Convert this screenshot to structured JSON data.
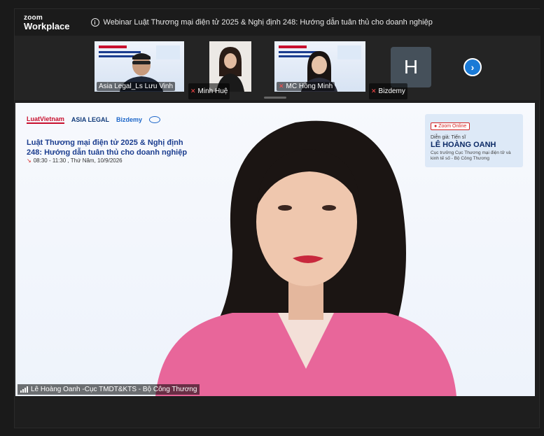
{
  "app": {
    "brand_line1": "zoom",
    "brand_line2": "Workplace"
  },
  "meeting": {
    "title": "Webinar Luật Thương mại điện tử 2025 & Nghị định 248: Hướng dẫn tuân thủ cho doanh nghiệp"
  },
  "participants": [
    {
      "name": "Asia Legal_Ls Lưu Vinh",
      "muted": false
    },
    {
      "name": "Minh Huệ",
      "muted": true
    },
    {
      "name": "MC Hồng Minh",
      "muted": true
    },
    {
      "name": "Bizdemy",
      "muted": true,
      "avatar_letter": "H"
    }
  ],
  "slide": {
    "logos": [
      "LuatVietnam",
      "ASIA LEGAL",
      "Bizdemy"
    ],
    "title": "Luật Thương mại điện tử 2025 & Nghị định 248: Hướng dẫn tuân thủ cho doanh nghiệp",
    "time": "08:30 - 11:30 , Thứ Năm, 10/9/2026",
    "zoom_tag": "Zoom Online",
    "speaker_role": "Diễn giả: Tiến sĩ",
    "speaker_name": "LÊ HOÀNG OANH",
    "speaker_desc": "Cục trưởng Cục Thương mại điện tử và kinh tế số - Bộ Công Thương"
  },
  "active_speaker": {
    "label": "Lê Hoàng Oanh -Cục TMDT&KTS - Bộ Công Thương"
  },
  "colors": {
    "accent": "#1a7ad6",
    "muted": "#ff4a4a",
    "slide_title": "#1b3d8f",
    "jacket": "#e8669a"
  }
}
